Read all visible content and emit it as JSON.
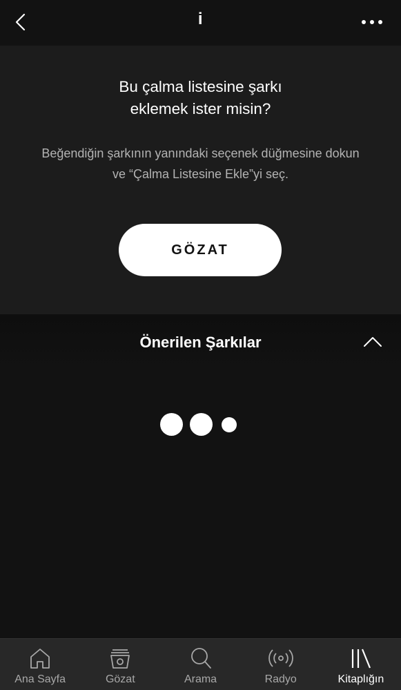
{
  "header": {
    "title": "i",
    "back_icon": "chevron-left-icon",
    "more_icon": "more-horizontal-icon"
  },
  "empty_state": {
    "title_line1": "Bu çalma listesine şarkı",
    "title_line2": "eklemek ister misin?",
    "description": "Beğendiğin şarkının yanındaki seçenek düğmesine dokun ve “Çalma Listesine Ekle”yi seç.",
    "browse_button": "GÖZAT"
  },
  "suggested": {
    "title": "Önerilen Şarkılar",
    "collapse_icon": "chevron-up-icon"
  },
  "tabs": [
    {
      "label": "Ana Sayfa",
      "icon": "home-icon",
      "active": false
    },
    {
      "label": "Gözat",
      "icon": "browse-icon",
      "active": false
    },
    {
      "label": "Arama",
      "icon": "search-icon",
      "active": false
    },
    {
      "label": "Radyo",
      "icon": "radio-icon",
      "active": false
    },
    {
      "label": "Kitaplığın",
      "icon": "library-icon",
      "active": true
    }
  ],
  "colors": {
    "background": "#121212",
    "panel": "#1c1c1c",
    "tabbar": "#282828",
    "text_primary": "#ffffff",
    "text_secondary": "#b3b3b3"
  }
}
